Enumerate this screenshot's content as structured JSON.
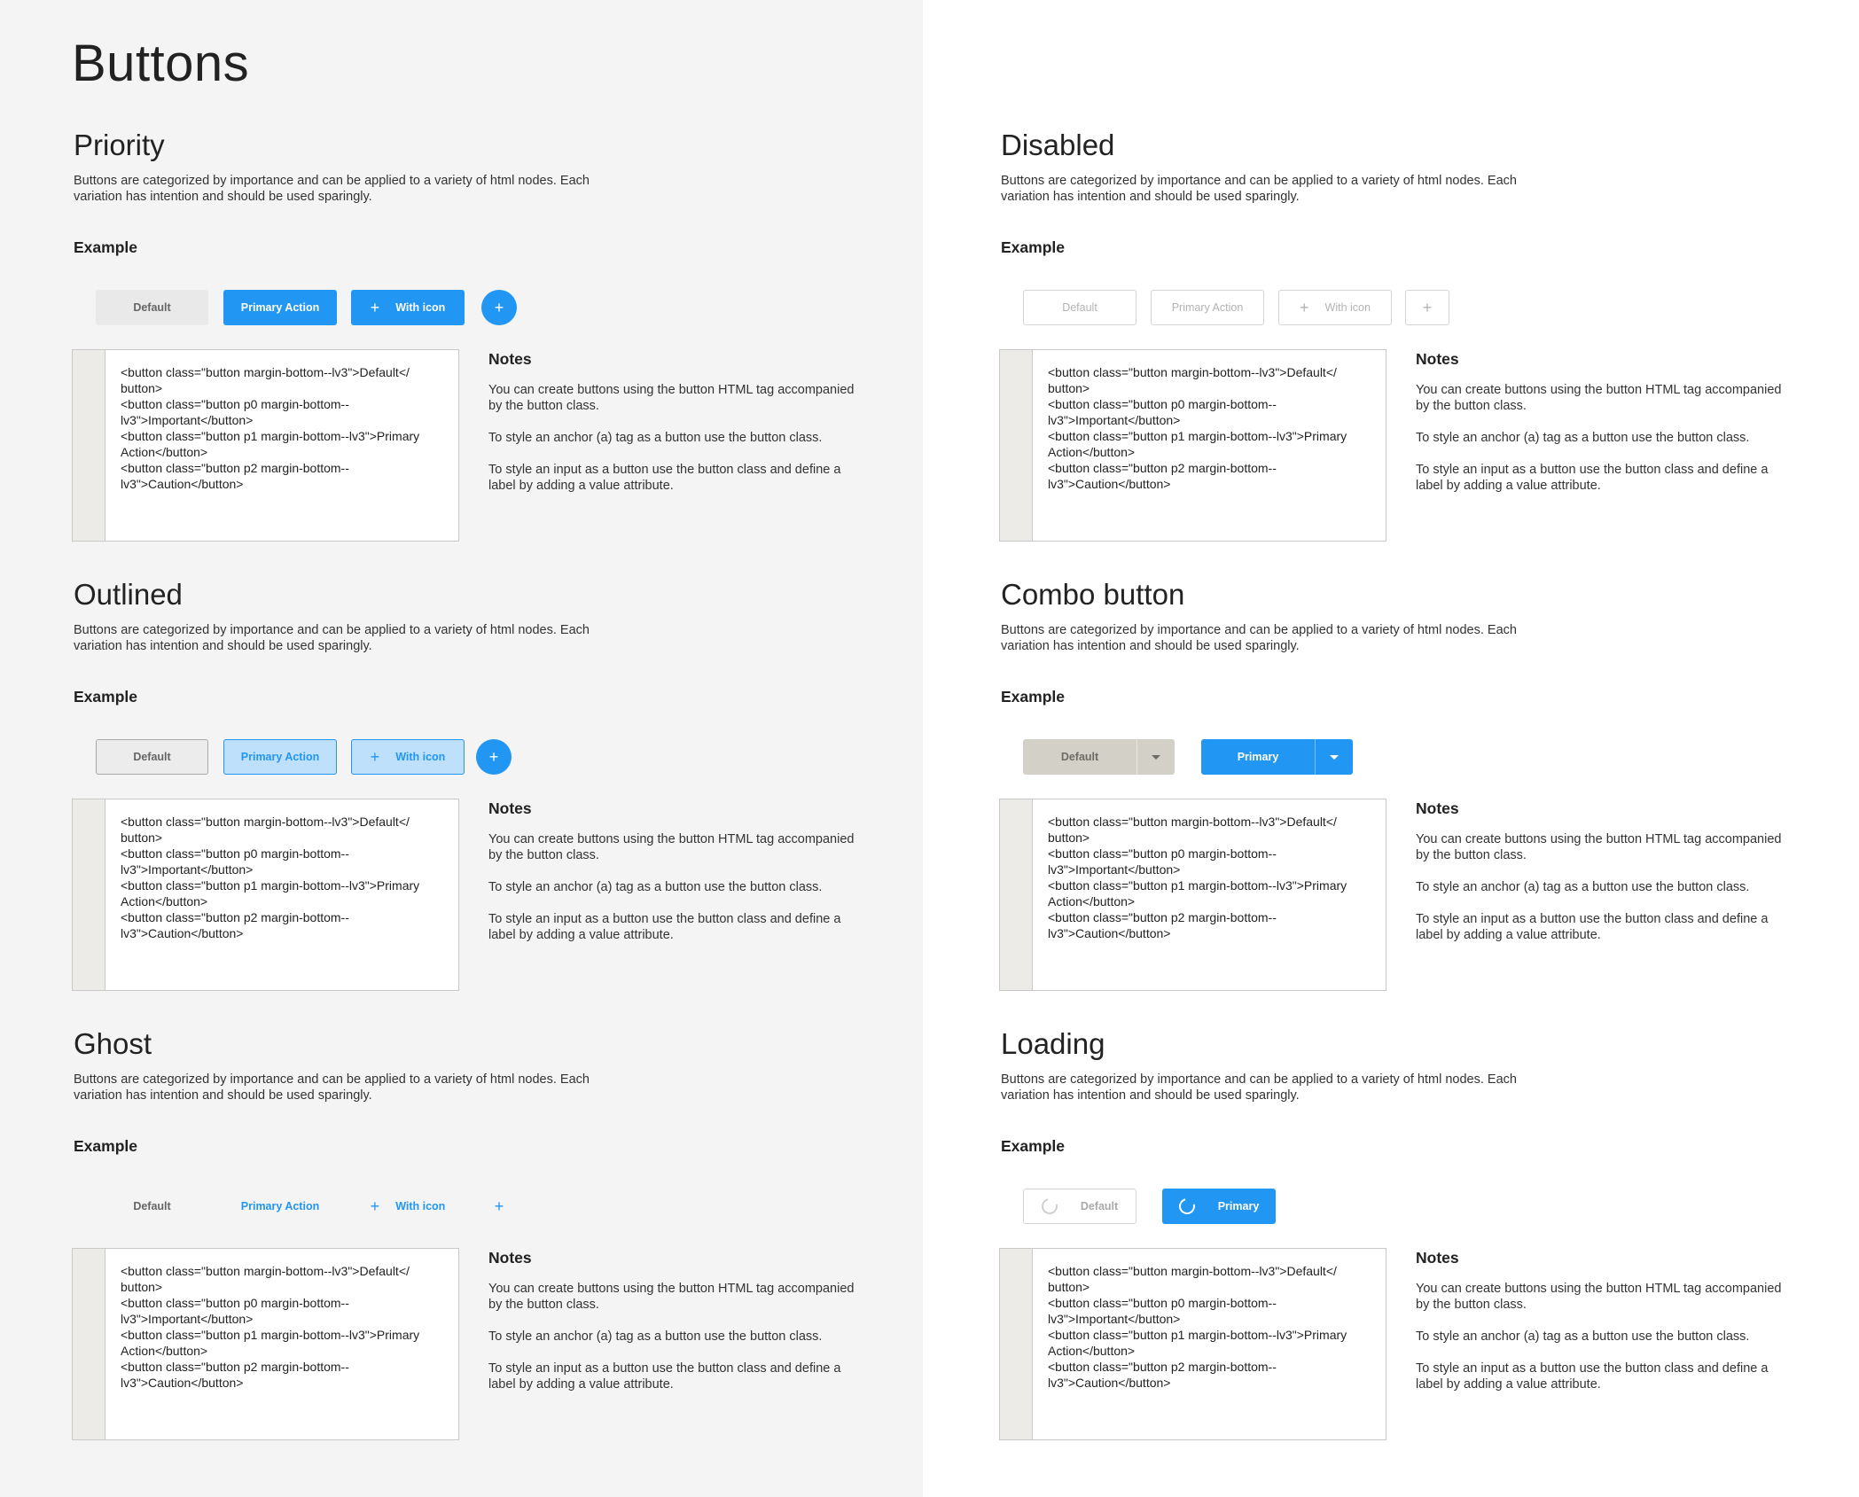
{
  "page_title": "Buttons",
  "common": {
    "desc": "Buttons are categorized by importance and can be applied to a variety of html nodes. Each variation has intention and should be used sparingly.",
    "example_label": "Example",
    "notes_title": "Notes",
    "code_lines": [
      "<button class=\"button margin-bottom--lv3\">Default</",
      "button>",
      "<button class=\"button p0 margin-bottom--",
      "lv3\">Important</button>",
      "<button class=\"button p1 margin-bottom--lv3\">Primary",
      "Action</button>",
      "<button class=\"button p2 margin-bottom--",
      "lv3\">Caution</button>"
    ],
    "notes": [
      "You can create buttons using the button HTML tag accompanied by the button class.",
      "To style an anchor (a) tag as a button use the button class.",
      "To style an input as a button use the button class and define a label by adding a value attribute."
    ]
  },
  "sections": {
    "priority": {
      "title": "Priority",
      "buttons": {
        "default": "Default",
        "primary": "Primary Action",
        "with_icon": "With icon",
        "icon": "+"
      }
    },
    "outlined": {
      "title": "Outlined",
      "buttons": {
        "default": "Default",
        "primary": "Primary Action",
        "with_icon": "With icon",
        "icon": "+"
      }
    },
    "ghost": {
      "title": "Ghost",
      "buttons": {
        "default": "Default",
        "primary": "Primary Action",
        "with_icon": "With icon",
        "icon": "+"
      }
    },
    "disabled": {
      "title": "Disabled",
      "buttons": {
        "default": "Default",
        "primary": "Primary Action",
        "with_icon": "With icon",
        "icon": "+"
      }
    },
    "combo": {
      "title": "Combo button",
      "buttons": {
        "default": "Default",
        "primary": "Primary"
      }
    },
    "loading": {
      "title": "Loading",
      "buttons": {
        "default": "Default",
        "primary": "Primary"
      }
    }
  },
  "colors": {
    "primary": "#2196f3",
    "left_background": "#f4f4f5",
    "right_background": "#ffffff",
    "gutter": "#ecebe7"
  },
  "icons": {
    "plus": "plus-icon",
    "caret": "caret-down-icon",
    "spinner": "loading-spinner-icon"
  }
}
